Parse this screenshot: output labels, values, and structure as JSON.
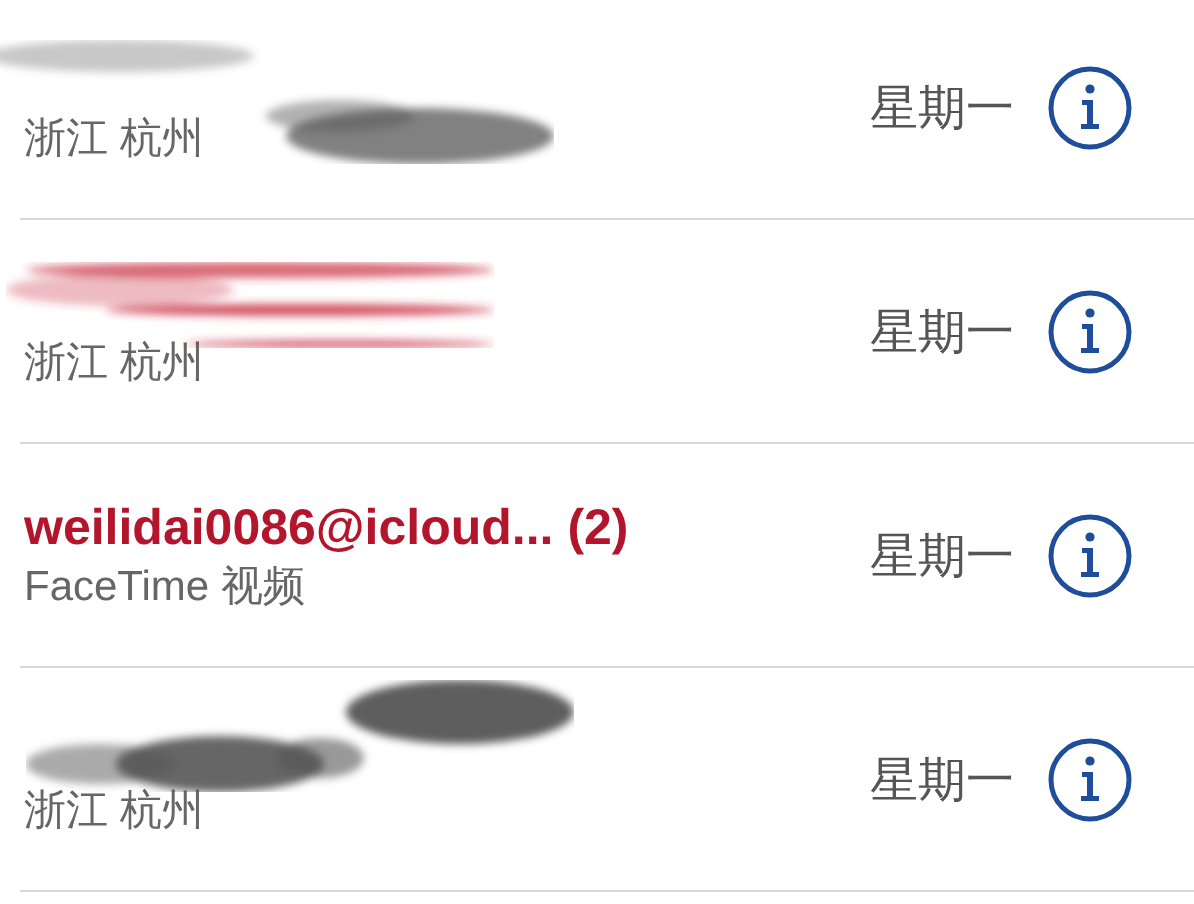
{
  "calls": [
    {
      "subtitle": "浙江 杭州",
      "day": "星期一",
      "missed": false,
      "redacted": true
    },
    {
      "subtitle": "浙江 杭州",
      "day": "星期一",
      "missed": true,
      "redacted": true
    },
    {
      "title": "weilidai0086@icloud... (2)",
      "subtitle": "FaceTime 视频",
      "day": "星期一",
      "missed": true,
      "redacted": false
    },
    {
      "subtitle": "浙江 杭州",
      "day": "星期一",
      "missed": false,
      "redacted": true
    }
  ]
}
